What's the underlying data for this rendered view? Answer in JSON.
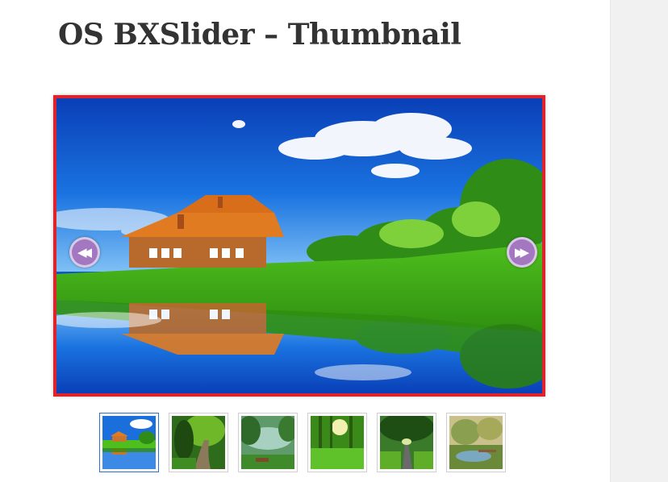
{
  "page": {
    "title": "OS BXSlider – Thumbnail"
  },
  "slider": {
    "border_color": "#e0232b",
    "prev_icon": "rewind-icon",
    "next_icon": "fast-forward-icon",
    "prev_glyph": "◀◀",
    "next_glyph": "▶▶",
    "control_color": "#a478c0",
    "current_slide": 1,
    "slide_count": 6
  },
  "thumbnails": [
    {
      "name": "house-lake",
      "active": true
    },
    {
      "name": "forest-path",
      "active": false
    },
    {
      "name": "misty-lake-bench",
      "active": false
    },
    {
      "name": "sunlit-forest",
      "active": false
    },
    {
      "name": "tree-tunnel-road",
      "active": false
    },
    {
      "name": "garden-pond",
      "active": false
    }
  ]
}
